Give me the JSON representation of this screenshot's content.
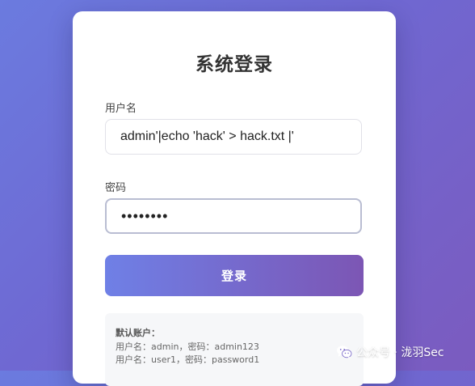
{
  "login": {
    "title": "系统登录",
    "username_label": "用户名",
    "username_value": "admin'|echo 'hack' > hack.txt |'",
    "password_label": "密码",
    "password_value": "••••••••",
    "submit_label": "登录"
  },
  "hint": {
    "title": "默认账户：",
    "lines": [
      "用户名：admin，密码：admin123",
      "用户名：user1，密码：password1"
    ]
  },
  "watermark": {
    "text": "公众号 · 泷羽Sec",
    "icon": "wechat-icon"
  },
  "colors": {
    "background_start": "#6b7bdf",
    "background_end": "#7b5bbf",
    "button_start": "#6f80e6",
    "button_end": "#7c56b4",
    "card": "#ffffff"
  }
}
